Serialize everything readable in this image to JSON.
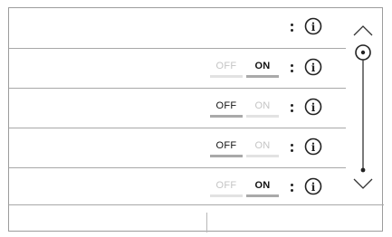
{
  "rows": [
    {
      "toggle": null
    },
    {
      "toggle": {
        "off_label": "OFF",
        "on_label": "ON",
        "state": "on"
      }
    },
    {
      "toggle": {
        "off_label": "OFF",
        "on_label": "ON",
        "state": "off"
      }
    },
    {
      "toggle": {
        "off_label": "OFF",
        "on_label": "ON",
        "state": "off"
      }
    },
    {
      "toggle": {
        "off_label": "OFF",
        "on_label": "ON",
        "state": "on"
      }
    }
  ],
  "icons": {
    "row_menu": "vertical-ellipsis-icon",
    "row_info": "info-icon",
    "scroll_up": "chevron-up-icon",
    "scroll_down": "chevron-down-icon",
    "scroll_handle": "scroll-handle-icon"
  },
  "scroll": {
    "position": 0
  }
}
